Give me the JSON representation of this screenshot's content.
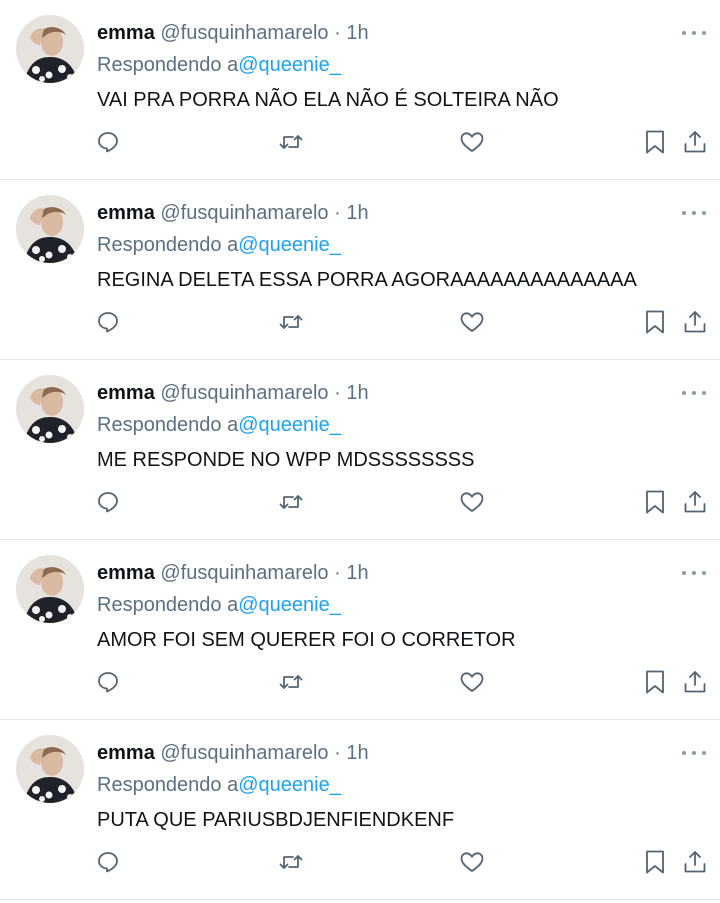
{
  "tweets": [
    {
      "name": "emma",
      "handle": "@fusquinhamarelo",
      "separator": "·",
      "time": "1h",
      "replying_label": "Respondendo a",
      "replying_to": "@queenie_",
      "text": "VAI PRA PORRA NÃO ELA NÃO É SOLTEIRA NÃO"
    },
    {
      "name": "emma",
      "handle": "@fusquinhamarelo",
      "separator": "·",
      "time": "1h",
      "replying_label": "Respondendo a",
      "replying_to": "@queenie_",
      "text": "REGINA DELETA ESSA PORRA AGORAAAAAAAAAAAAAA"
    },
    {
      "name": "emma",
      "handle": "@fusquinhamarelo",
      "separator": "·",
      "time": "1h",
      "replying_label": "Respondendo a",
      "replying_to": "@queenie_",
      "text": "ME RESPONDE NO WPP MDSSSSSSSS"
    },
    {
      "name": "emma",
      "handle": "@fusquinhamarelo",
      "separator": "·",
      "time": "1h",
      "replying_label": "Respondendo a",
      "replying_to": "@queenie_",
      "text": "AMOR FOI SEM QUERER FOI O CORRETOR"
    },
    {
      "name": "emma",
      "handle": "@fusquinhamarelo",
      "separator": "·",
      "time": "1h",
      "replying_label": "Respondendo a",
      "replying_to": "@queenie_",
      "text": "PUTA QUE PARIUSBDJENFIENDKENF"
    }
  ],
  "icons": {
    "reply": "reply-icon",
    "retweet": "retweet-icon",
    "like": "like-icon",
    "bookmark": "bookmark-icon",
    "share": "share-icon",
    "more": "more-options-icon"
  },
  "colors": {
    "text": "#0f1419",
    "secondary": "#5b7083",
    "mention": "#1da1f2",
    "icon": "#536471",
    "divider": "#e1e6ea"
  }
}
